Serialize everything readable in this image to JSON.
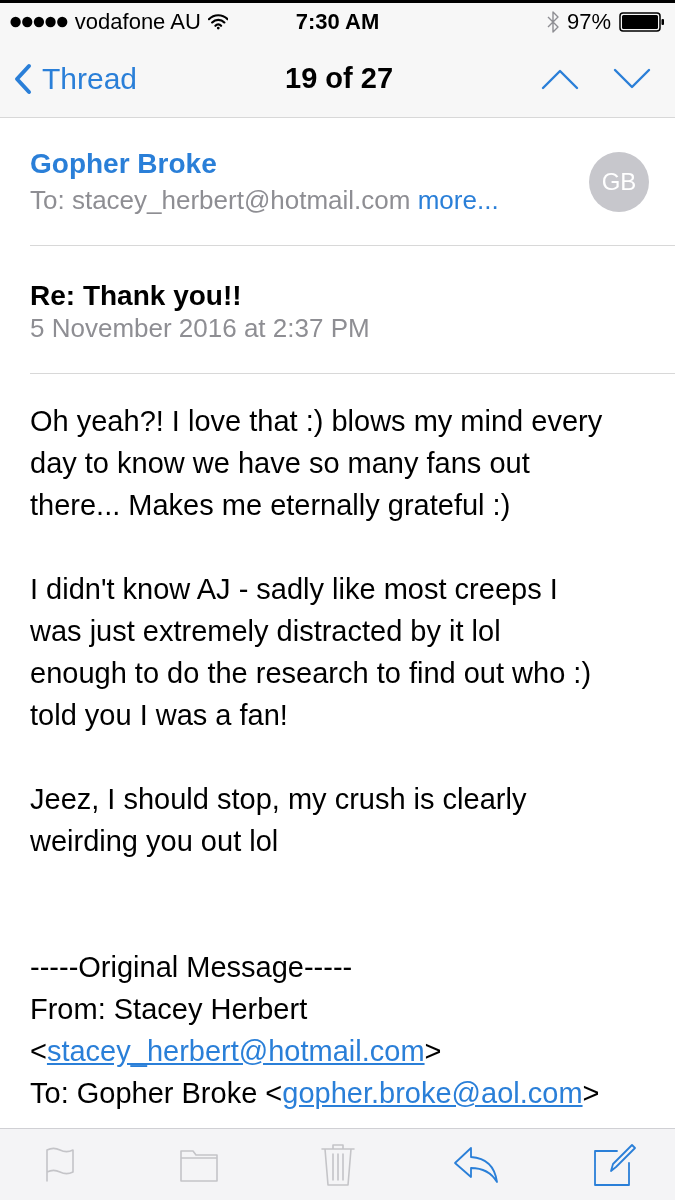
{
  "status_bar": {
    "carrier": "vodafone AU",
    "time": "7:30 AM",
    "battery": "97%"
  },
  "nav_bar": {
    "back_label": "Thread",
    "title": "19 of 27"
  },
  "header": {
    "sender": "Gopher Broke",
    "to_label": "To:",
    "to_address": "stacey_herbert@hotmail.com",
    "more": "more...",
    "avatar_initials": "GB"
  },
  "subject": {
    "title": "Re: Thank you!!",
    "date": "5 November 2016 at 2:37 PM"
  },
  "body": {
    "paragraphs": [
      [
        "Oh yeah?! I love that :) blows my mind every",
        "day to know we have so many fans out",
        "there... Makes me eternally grateful :)"
      ],
      [
        "I didn't know AJ - sadly like most creeps I",
        "was just extremely distracted by it lol",
        "enough to do the research to find out who :)",
        "told you I was a fan!"
      ],
      [
        "Jeez, I should stop, my crush is clearly",
        "weirding you out lol"
      ]
    ],
    "quoted": {
      "heading": "-----Original Message-----",
      "lines": [
        {
          "before": "From: Stacey Herbert"
        },
        {
          "before": "<",
          "link": "stacey_herbert@hotmail.com",
          "after": ">"
        },
        {
          "before": "To: Gopher Broke <",
          "link": "gopher.broke@aol.com",
          "after": ">"
        }
      ]
    }
  },
  "toolbar": [
    {
      "kind": "flag",
      "disabled": true
    },
    {
      "kind": "folder",
      "disabled": true
    },
    {
      "kind": "trash",
      "disabled": true
    },
    {
      "kind": "reply",
      "disabled": false
    },
    {
      "kind": "compose",
      "disabled": false
    }
  ]
}
